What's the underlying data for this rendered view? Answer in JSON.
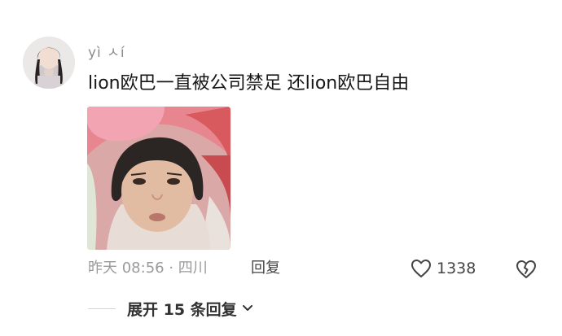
{
  "comment": {
    "username": "yì ㅅí",
    "text": "lion欧巴一直被公司禁足 还lion欧巴自由",
    "timestamp": "昨天 08:56 · 四川",
    "reply_label": "回复",
    "like_count": "1338"
  },
  "replies": {
    "expand_label": "展开 15 条回复"
  },
  "icons": {
    "avatar": "user-avatar-photo",
    "like": "heart-outline-icon",
    "dislike": "broken-heart-icon",
    "expand": "chevron-down-icon"
  },
  "colors": {
    "meta_text": "#9a9a9a",
    "username": "#8b8b8b",
    "body_text": "#161616"
  }
}
